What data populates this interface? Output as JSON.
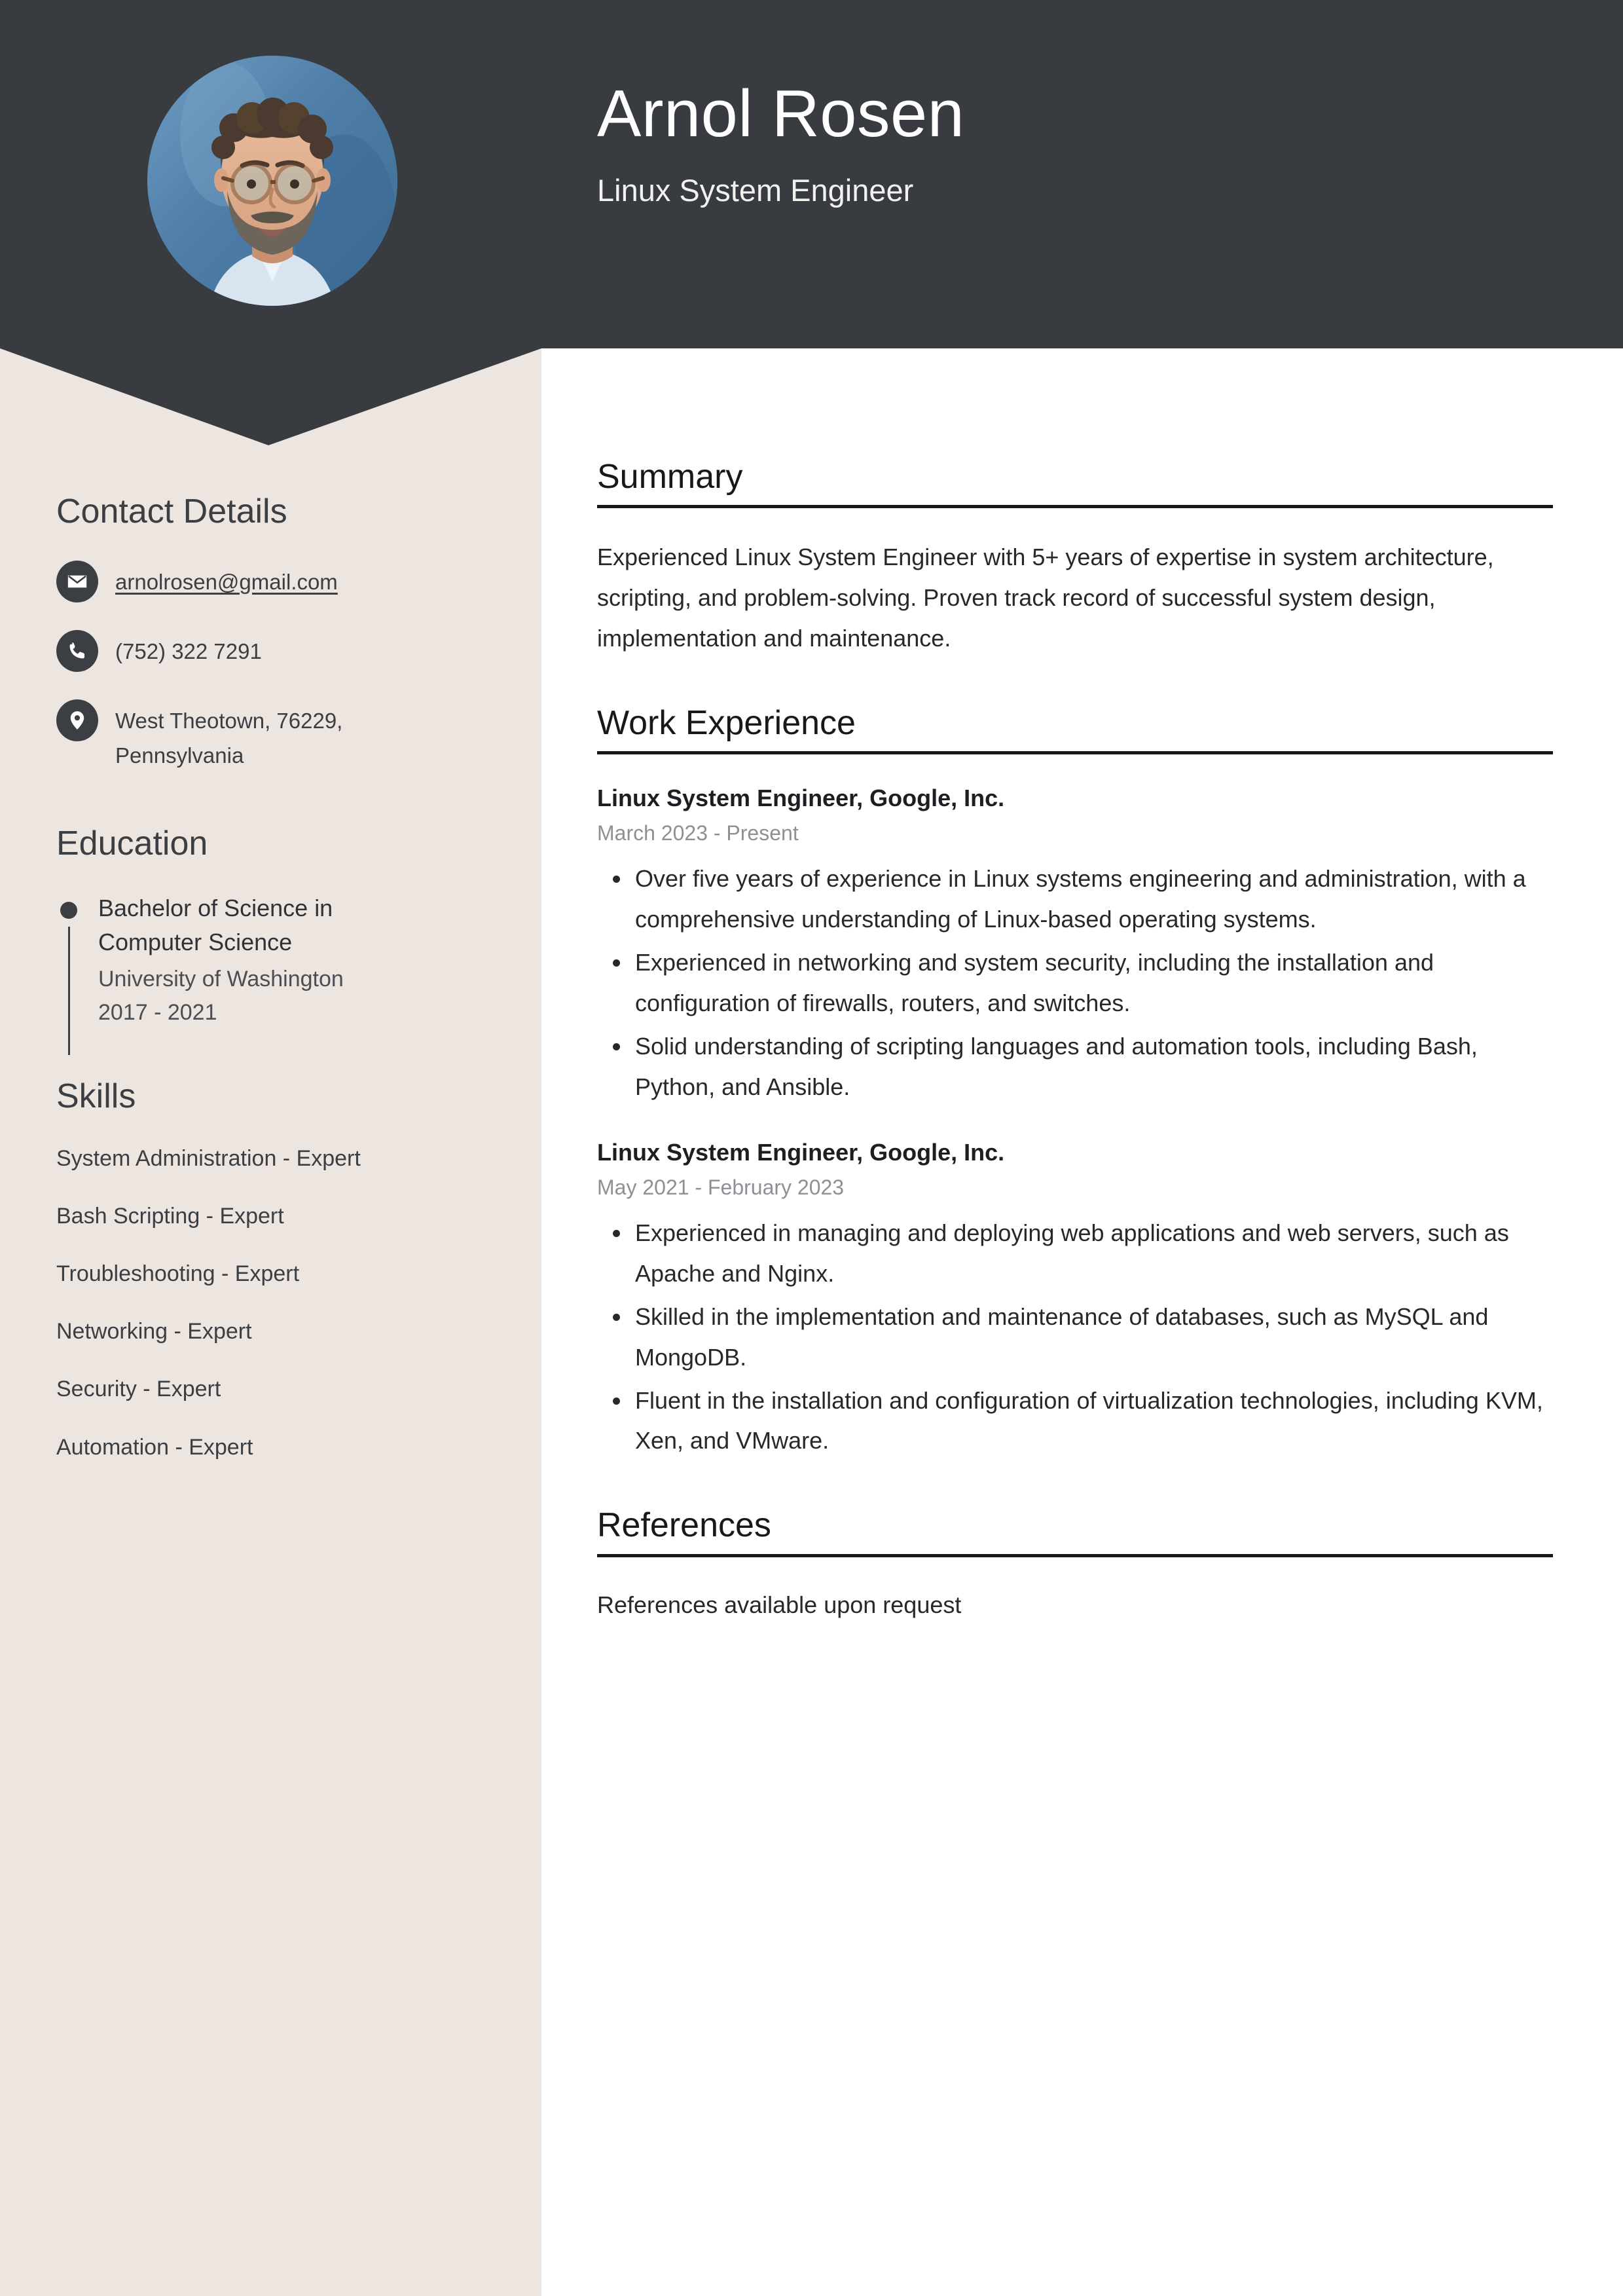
{
  "header": {
    "name": "Arnol Rosen",
    "job_title": "Linux System Engineer",
    "avatar_alt": "profile-photo",
    "background_color": "#383B40"
  },
  "sidebar": {
    "background_color": "#EDE5DF",
    "contact": {
      "heading": "Contact Details",
      "items": [
        {
          "icon": "envelope-icon",
          "value": "arnolrosen@gmail.com",
          "is_link": true
        },
        {
          "icon": "phone-icon",
          "value": "(752) 322 7291",
          "is_link": false
        },
        {
          "icon": "location-pin-icon",
          "value": "West Theotown, 76229, Pennsylvania",
          "is_link": false
        }
      ]
    },
    "education": {
      "heading": "Education",
      "items": [
        {
          "degree": "Bachelor of Science in Computer Science",
          "school": "University of Washington",
          "dates": "2017 - 2021"
        }
      ]
    },
    "skills": {
      "heading": "Skills",
      "items": [
        "System Administration - Expert",
        "Bash Scripting - Expert",
        "Troubleshooting - Expert",
        "Networking - Expert",
        "Security - Expert",
        "Automation - Expert"
      ]
    }
  },
  "main": {
    "summary": {
      "heading": "Summary",
      "text": "Experienced Linux System Engineer with 5+ years of expertise in system architecture, scripting, and problem-solving. Proven track record of successful system design, implementation and maintenance."
    },
    "work_experience": {
      "heading": "Work Experience",
      "jobs": [
        {
          "role": "Linux System Engineer, Google, Inc.",
          "dates": "March 2023 - Present",
          "bullets": [
            "Over five years of experience in Linux systems engineering and administration, with a comprehensive understanding of Linux-based operating systems.",
            "Experienced in networking and system security, including the installation and configuration of firewalls, routers, and switches.",
            "Solid understanding of scripting languages and automation tools, including Bash, Python, and Ansible."
          ]
        },
        {
          "role": "Linux System Engineer, Google, Inc.",
          "dates": "May 2021 - February 2023",
          "bullets": [
            "Experienced in managing and deploying web applications and web servers, such as Apache and Nginx.",
            "Skilled in the implementation and maintenance of databases, such as MySQL and MongoDB.",
            "Fluent in the installation and configuration of virtualization technologies, including KVM, Xen, and VMware."
          ]
        }
      ]
    },
    "references": {
      "heading": "References",
      "text": "References available upon request"
    }
  }
}
